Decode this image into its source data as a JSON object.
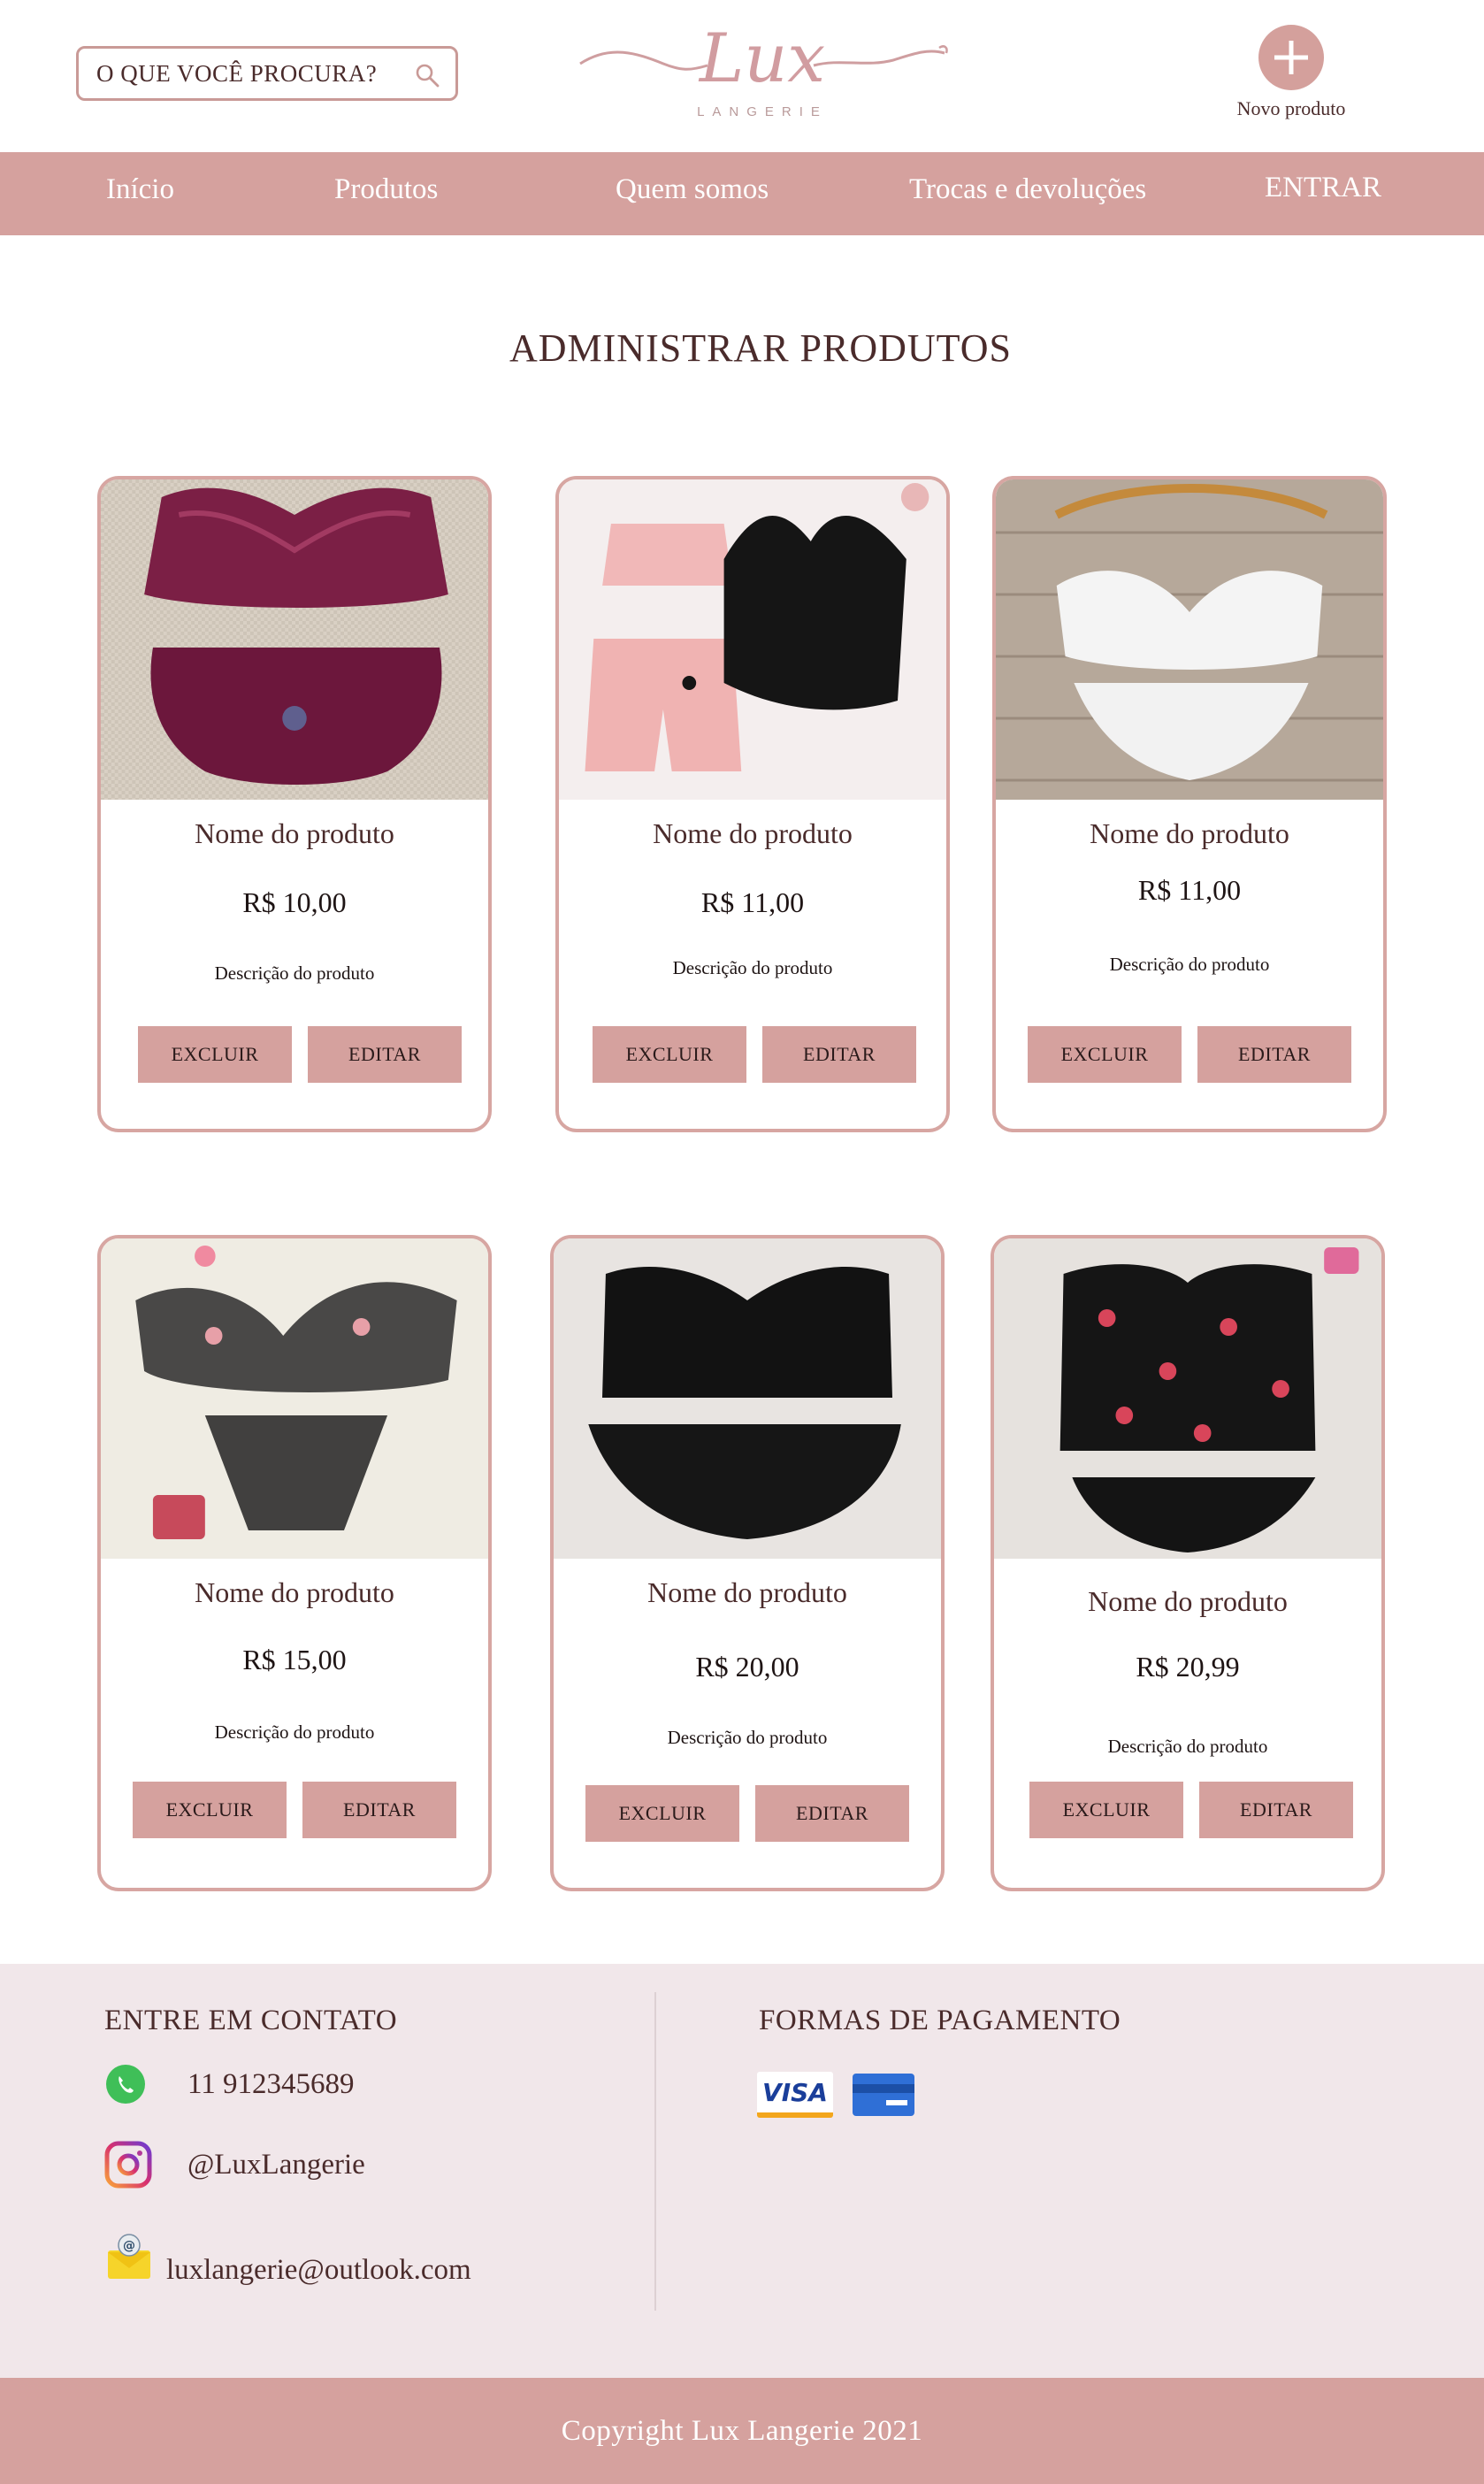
{
  "header": {
    "search_placeholder": "O QUE VOCÊ PROCURA?",
    "logo_text": "Lux",
    "logo_sub": "LANGERIE",
    "new_product_label": "Novo produto"
  },
  "nav": {
    "items": [
      {
        "label": "Início"
      },
      {
        "label": "Produtos"
      },
      {
        "label": "Quem somos"
      },
      {
        "label": "Trocas e devoluções"
      },
      {
        "label": "ENTRAR"
      }
    ]
  },
  "page_title": "ADMINISTRAR PRODUTOS",
  "products": [
    {
      "name": "Nome do produto",
      "price": "R$ 10,00",
      "description": "Descrição do produto",
      "delete_label": "EXCLUIR",
      "edit_label": "EDITAR"
    },
    {
      "name": "Nome do produto",
      "price": "R$ 11,00",
      "description": "Descrição do produto",
      "delete_label": "EXCLUIR",
      "edit_label": "EDITAR"
    },
    {
      "name": "Nome do produto",
      "price": "R$ 11,00",
      "description": "Descrição do produto",
      "delete_label": "EXCLUIR",
      "edit_label": "EDITAR"
    },
    {
      "name": "Nome do produto",
      "price": "R$ 15,00",
      "description": "Descrição do produto",
      "delete_label": "EXCLUIR",
      "edit_label": "EDITAR"
    },
    {
      "name": "Nome do produto",
      "price": "R$ 20,00",
      "description": "Descrição do produto",
      "delete_label": "EXCLUIR",
      "edit_label": "EDITAR"
    },
    {
      "name": "Nome do produto",
      "price": "R$ 20,99",
      "description": "Descrição do produto",
      "delete_label": "EXCLUIR",
      "edit_label": "EDITAR"
    }
  ],
  "footer": {
    "contact_title": "ENTRE EM CONTATO",
    "phone": "11 912345689",
    "instagram": "@LuxLangerie",
    "email": "luxlangerie@outlook.com",
    "payment_title": "FORMAS DE PAGAMENTO",
    "visa_label": "VISA",
    "copyright": "Copyright Lux Langerie 2021"
  },
  "colors": {
    "accent": "#d5a19e",
    "text": "#4a2b2b",
    "footer_bg": "#f1e7ea"
  }
}
